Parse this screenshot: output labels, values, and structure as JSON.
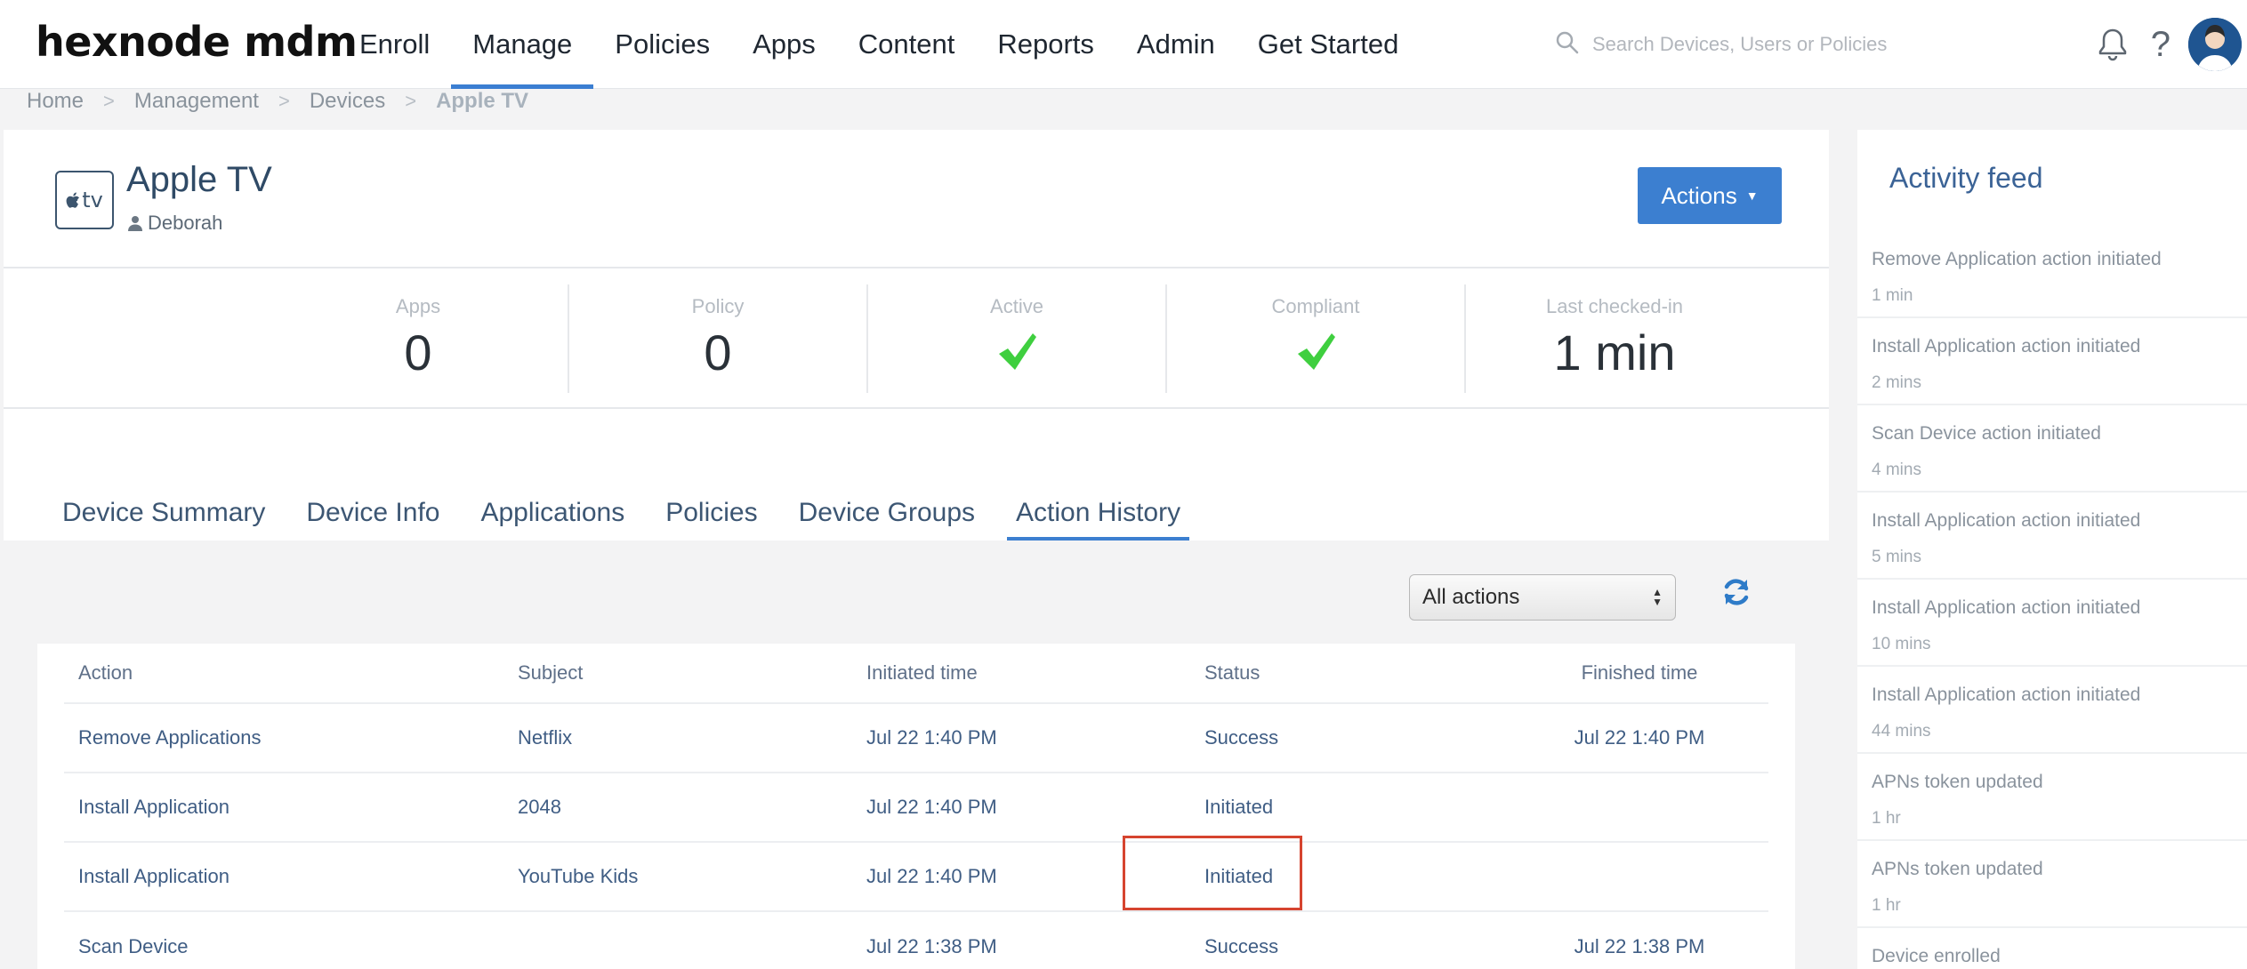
{
  "brand": {
    "logo": "hexnode mdm"
  },
  "nav": {
    "items": [
      {
        "label": "Enroll"
      },
      {
        "label": "Manage",
        "active": true
      },
      {
        "label": "Policies"
      },
      {
        "label": "Apps"
      },
      {
        "label": "Content"
      },
      {
        "label": "Reports"
      },
      {
        "label": "Admin"
      },
      {
        "label": "Get Started"
      }
    ]
  },
  "search": {
    "placeholder": "Search Devices, Users or Policies"
  },
  "header_icons": {
    "bell": "bell-icon",
    "help": "?",
    "avatar": "avatar"
  },
  "breadcrumb": [
    "Home",
    "Management",
    "Devices",
    "Apple TV"
  ],
  "device": {
    "icon_text": "tv",
    "name": "Apple TV",
    "user": "Deborah",
    "actions_label": "Actions"
  },
  "stats": [
    {
      "label": "Apps",
      "value": "0"
    },
    {
      "label": "Policy",
      "value": "0"
    },
    {
      "label": "Active",
      "icon": "check-icon"
    },
    {
      "label": "Compliant",
      "icon": "check-icon"
    },
    {
      "label": "Last checked-in",
      "value": "1 min"
    }
  ],
  "tabs": [
    {
      "label": "Device Summary"
    },
    {
      "label": "Device Info"
    },
    {
      "label": "Applications"
    },
    {
      "label": "Policies"
    },
    {
      "label": "Device Groups"
    },
    {
      "label": "Action History",
      "active": true
    }
  ],
  "filter": {
    "selected": "All actions"
  },
  "table": {
    "headers": [
      "Action",
      "Subject",
      "Initiated time",
      "Status",
      "Finished time"
    ],
    "rows": [
      [
        "Remove Applications",
        "Netflix",
        "Jul 22 1:40 PM",
        "Success",
        "Jul 22 1:40 PM"
      ],
      [
        "Install Application",
        "2048",
        "Jul 22 1:40 PM",
        "Initiated",
        ""
      ],
      [
        "Install Application",
        "YouTube Kids",
        "Jul 22 1:40 PM",
        "Initiated",
        ""
      ],
      [
        "Scan Device",
        "",
        "Jul 22 1:38 PM",
        "Success",
        "Jul 22 1:38 PM"
      ]
    ]
  },
  "feed": {
    "title": "Activity feed",
    "items": [
      {
        "text": "Remove Application action initiated",
        "time": "1 min"
      },
      {
        "text": "Install Application action initiated",
        "time": "2 mins"
      },
      {
        "text": "Scan Device action initiated",
        "time": "4 mins"
      },
      {
        "text": "Install Application action initiated",
        "time": "5 mins"
      },
      {
        "text": "Install Application action initiated",
        "time": "10 mins"
      },
      {
        "text": "Install Application action initiated",
        "time": "44 mins"
      },
      {
        "text": "APNs token updated",
        "time": "1 hr"
      },
      {
        "text": "APNs token updated",
        "time": "1 hr"
      },
      {
        "text": "Device enrolled",
        "time": ""
      }
    ]
  },
  "colors": {
    "accent": "#3c7fd0",
    "check": "#3fcf3f",
    "highlight": "#d6442f"
  }
}
